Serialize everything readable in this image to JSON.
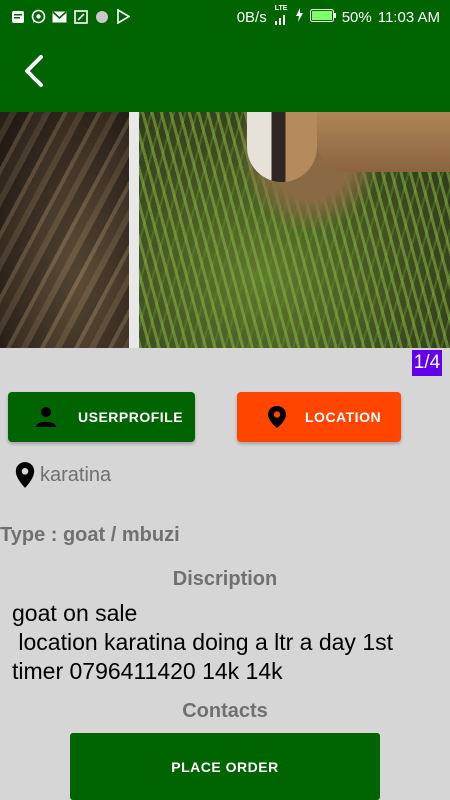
{
  "status_bar": {
    "net_speed": "0B/s",
    "network_label": "LTE",
    "battery": "50%",
    "time": "11:03 AM",
    "icons": [
      "message-icon",
      "whatsapp-icon",
      "gmail-icon",
      "screenshot-icon",
      "circle-icon",
      "play-store-icon"
    ]
  },
  "toolbar": {
    "back_icon": "arrow-back-icon"
  },
  "gallery": {
    "counter": "1/4"
  },
  "buttons": {
    "user_profile": "USERPROFILE",
    "location": "LOCATION",
    "user_profile_color": "#006400",
    "location_color": "#ff4500"
  },
  "listing": {
    "location": "karatina",
    "type": "Type : goat / mbuzi",
    "description_heading": "Discription",
    "description": "goat on sale\n location karatina doing a ltr a day 1st timer 0796411420 14k 14k",
    "contacts_heading": "Contacts"
  },
  "order": {
    "label": "PLACE ORDER"
  },
  "colors": {
    "primary": "#006400",
    "accent": "#ff4500",
    "counter_bg": "#6200ee",
    "background": "#d6d6d6"
  }
}
